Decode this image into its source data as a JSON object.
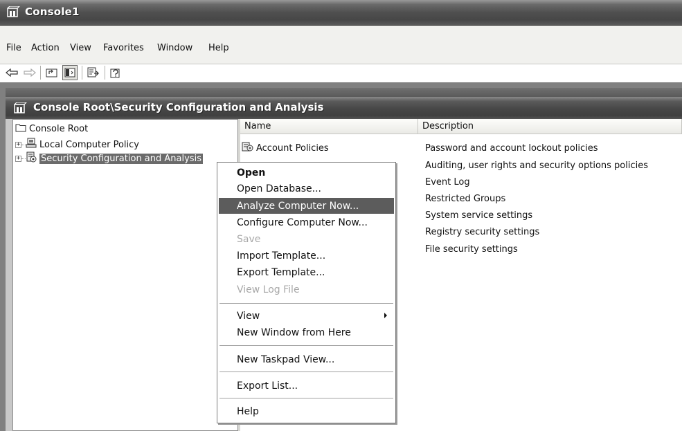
{
  "window": {
    "title": "Console1"
  },
  "menu": [
    "File",
    "Action",
    "View",
    "Favorites",
    "Window",
    "Help"
  ],
  "toolbar": {
    "buttons": [
      "back-icon",
      "forward-icon",
      "up-one-level-icon",
      "show-hide-tree-icon",
      "export-list-icon",
      "help-icon"
    ],
    "pressed": "show-hide-tree-icon"
  },
  "child": {
    "title": "Console Root\\Security Configuration and Analysis"
  },
  "tree": {
    "root": "Console Root",
    "items": [
      "Local Computer Policy",
      "Security Configuration and Analysis"
    ],
    "selected": "Security Configuration and Analysis"
  },
  "list": {
    "columns": [
      "Name",
      "Description"
    ],
    "rows": [
      {
        "name": "Account Policies",
        "description": "Password and account lockout policies"
      },
      {
        "name": "",
        "description": "Auditing, user rights and security options policies"
      },
      {
        "name": "",
        "description": "Event Log"
      },
      {
        "name": "",
        "description": "Restricted Groups"
      },
      {
        "name": "",
        "description": "System service settings"
      },
      {
        "name": "",
        "description": "Registry security settings"
      },
      {
        "name": "",
        "description": "File security settings"
      }
    ]
  },
  "context_menu": {
    "items": [
      {
        "label": "Open",
        "bold": true
      },
      {
        "label": "Open Database..."
      },
      {
        "label": "Analyze Computer Now...",
        "highlighted": true
      },
      {
        "label": "Configure Computer Now..."
      },
      {
        "label": "Save",
        "disabled": true
      },
      {
        "label": "Import Template..."
      },
      {
        "label": "Export Template..."
      },
      {
        "label": "View Log File",
        "disabled": true
      },
      {
        "label": "View",
        "submenu": true
      },
      {
        "label": "New Window from Here"
      },
      {
        "label": "New Taskpad View..."
      },
      {
        "label": "Export List..."
      },
      {
        "label": "Help"
      }
    ]
  },
  "colors": {
    "title_bar": "#474747",
    "selection": "#5c5c5c",
    "background": "#ffffff",
    "mdi_background": "#808080"
  }
}
